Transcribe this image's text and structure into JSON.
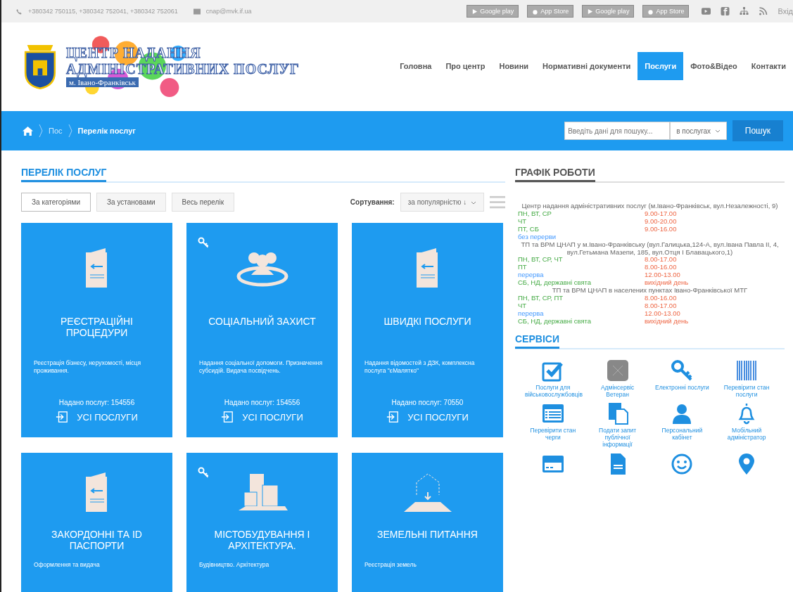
{
  "top_bar": {
    "phones": "+380342 750115, +380342 752041, +380342 752061",
    "email": "cnap@mvk.if.ua",
    "app_buttons": [
      {
        "label": "Google play",
        "kind": "play"
      },
      {
        "label": "App Store",
        "kind": "apple"
      },
      {
        "label": "Google play",
        "kind": "play"
      },
      {
        "label": "App Store",
        "kind": "apple"
      }
    ],
    "login": "Вхід"
  },
  "logo": {
    "line1": "ЦЕНТР НАДАННЯ",
    "line2": "АДМІНІСТРАТИВНИХ ПОСЛУГ",
    "line3": "м. Івано-Франківськ"
  },
  "nav": [
    {
      "label": "Головна",
      "selected": false
    },
    {
      "label": "Про центр",
      "selected": false
    },
    {
      "label": "Новини",
      "selected": false
    },
    {
      "label": "Нормативні документи",
      "selected": false
    },
    {
      "label": "Послуги",
      "selected": true
    },
    {
      "label": "Фото&Відео",
      "selected": false
    },
    {
      "label": "Контакти",
      "selected": false
    }
  ],
  "breadcrumb": [
    "Пос",
    "Перелік послуг"
  ],
  "search": {
    "placeholder": "Введіть дані для пошуку...",
    "scope": "в послугах",
    "button": "Пошук"
  },
  "services": {
    "title": "ПЕРЕЛІК ПОСЛУГ",
    "filters": [
      {
        "label": "За категоріями",
        "selected": true
      },
      {
        "label": "За установами",
        "selected": false
      },
      {
        "label": "Весь перелік",
        "selected": false
      }
    ],
    "sort_label": "Сортування:",
    "sort_value": "за популярністю ↓",
    "cards": [
      {
        "kind": "document",
        "key_badge": false,
        "title": "РЕЄСТРАЦІЙНІ ПРОЦЕДУРИ",
        "description": "Реєстрація бізнесу, нерухомості, місця проживання.",
        "count": "Надано послуг: 154556",
        "link": "УСІ ПОСЛУГИ"
      },
      {
        "kind": "people",
        "key_badge": true,
        "title": "СОЦІАЛЬНИЙ ЗАХИСТ",
        "description": "Надання соціальної допомоги. Призначення субсидій. Видача посвідчень.",
        "count": "Надано послуг: 154556",
        "link": "УСІ ПОСЛУГИ"
      },
      {
        "kind": "document",
        "key_badge": false,
        "title": "ШВИДКІ ПОСЛУГИ",
        "description": "Надання відомостей з ДЗК, комплексна послуга \"єМалятко\"",
        "count": "Надано послуг: 70550",
        "link": "УСІ ПОСЛУГИ"
      },
      {
        "kind": "document",
        "key_badge": false,
        "title": "ЗАКОРДОННІ ТА ID ПАСПОРТИ",
        "description": "Оформлення та видача"
      },
      {
        "kind": "buildings",
        "key_badge": true,
        "title": "МІСТОБУДУВАННЯ І АРХІТЕКТУРА.",
        "description": "Будівництво. Архітектура"
      },
      {
        "kind": "land",
        "key_badge": false,
        "title": "ЗЕМЕЛЬНІ ПИТАННЯ",
        "description": "Реєстрація земель"
      }
    ]
  },
  "schedule": {
    "title": "ГРАФІК РОБОТИ",
    "blocks": [
      {
        "heading": "Центр надання адміністративних послуг (м.Івано-Франківськ, вул.Незалежності, 9)",
        "rows": [
          {
            "kind": "days",
            "label": "ПН, ВТ, СР",
            "time": "9.00-17.00"
          },
          {
            "kind": "days",
            "label": "ЧТ",
            "time": "9.00-20.00"
          },
          {
            "kind": "days",
            "label": "ПТ, СБ",
            "time": "9.00-16.00"
          },
          {
            "kind": "break",
            "label": "без перерви"
          }
        ]
      },
      {
        "heading": "ТП та ВРМ ЦНАП у м.Івано-Франківську (вул.Галицька,124-А, вул.Івана Павла II, 4, вул.Гетьмана Мазепи, 185, вул.Отця І Блавацького,1)",
        "rows": [
          {
            "kind": "days",
            "label": "ПН, ВТ, СР, ЧТ",
            "time": "8.00-17.00"
          },
          {
            "kind": "days",
            "label": "ПТ",
            "time": "8.00-16.00"
          },
          {
            "kind": "break",
            "label": "перерва",
            "time": "12.00-13.00"
          },
          {
            "kind": "days",
            "label": "СБ, НД, державні свята",
            "time": "вихідний день"
          }
        ]
      },
      {
        "heading": "ТП та ВРМ ЦНАП в населених пунктах Івано-Франківської МТГ",
        "rows": [
          {
            "kind": "days",
            "label": "ПН, ВТ, СР, ПТ",
            "time": "8.00-16.00"
          },
          {
            "kind": "days",
            "label": "ЧТ",
            "time": "8.00-17.00"
          },
          {
            "kind": "break",
            "label": "перерва",
            "time": "12.00-13.00"
          },
          {
            "kind": "days",
            "label": "СБ, НД, державні свята",
            "time": "вихідний день"
          }
        ]
      }
    ]
  },
  "tools": {
    "title": "СЕРВІСИ",
    "items": [
      {
        "kind": "check",
        "label": "Послуги для військовослужбовців"
      },
      {
        "kind": "grey",
        "label": "Адмінсервіс Ветеран"
      },
      {
        "kind": "key",
        "label": "Електронні послуги"
      },
      {
        "kind": "barcode",
        "label": "Перевірити стан послуги"
      },
      {
        "kind": "list",
        "label": "Перевірити стан черги"
      },
      {
        "kind": "docs",
        "label": "Подати запит публічної інформації"
      },
      {
        "kind": "person",
        "label": "Персональний кабінет"
      },
      {
        "kind": "bell",
        "label": "Мобільний адміністратор"
      },
      {
        "kind": "card"
      },
      {
        "kind": "file"
      },
      {
        "kind": "smile"
      },
      {
        "kind": "pin"
      }
    ]
  }
}
